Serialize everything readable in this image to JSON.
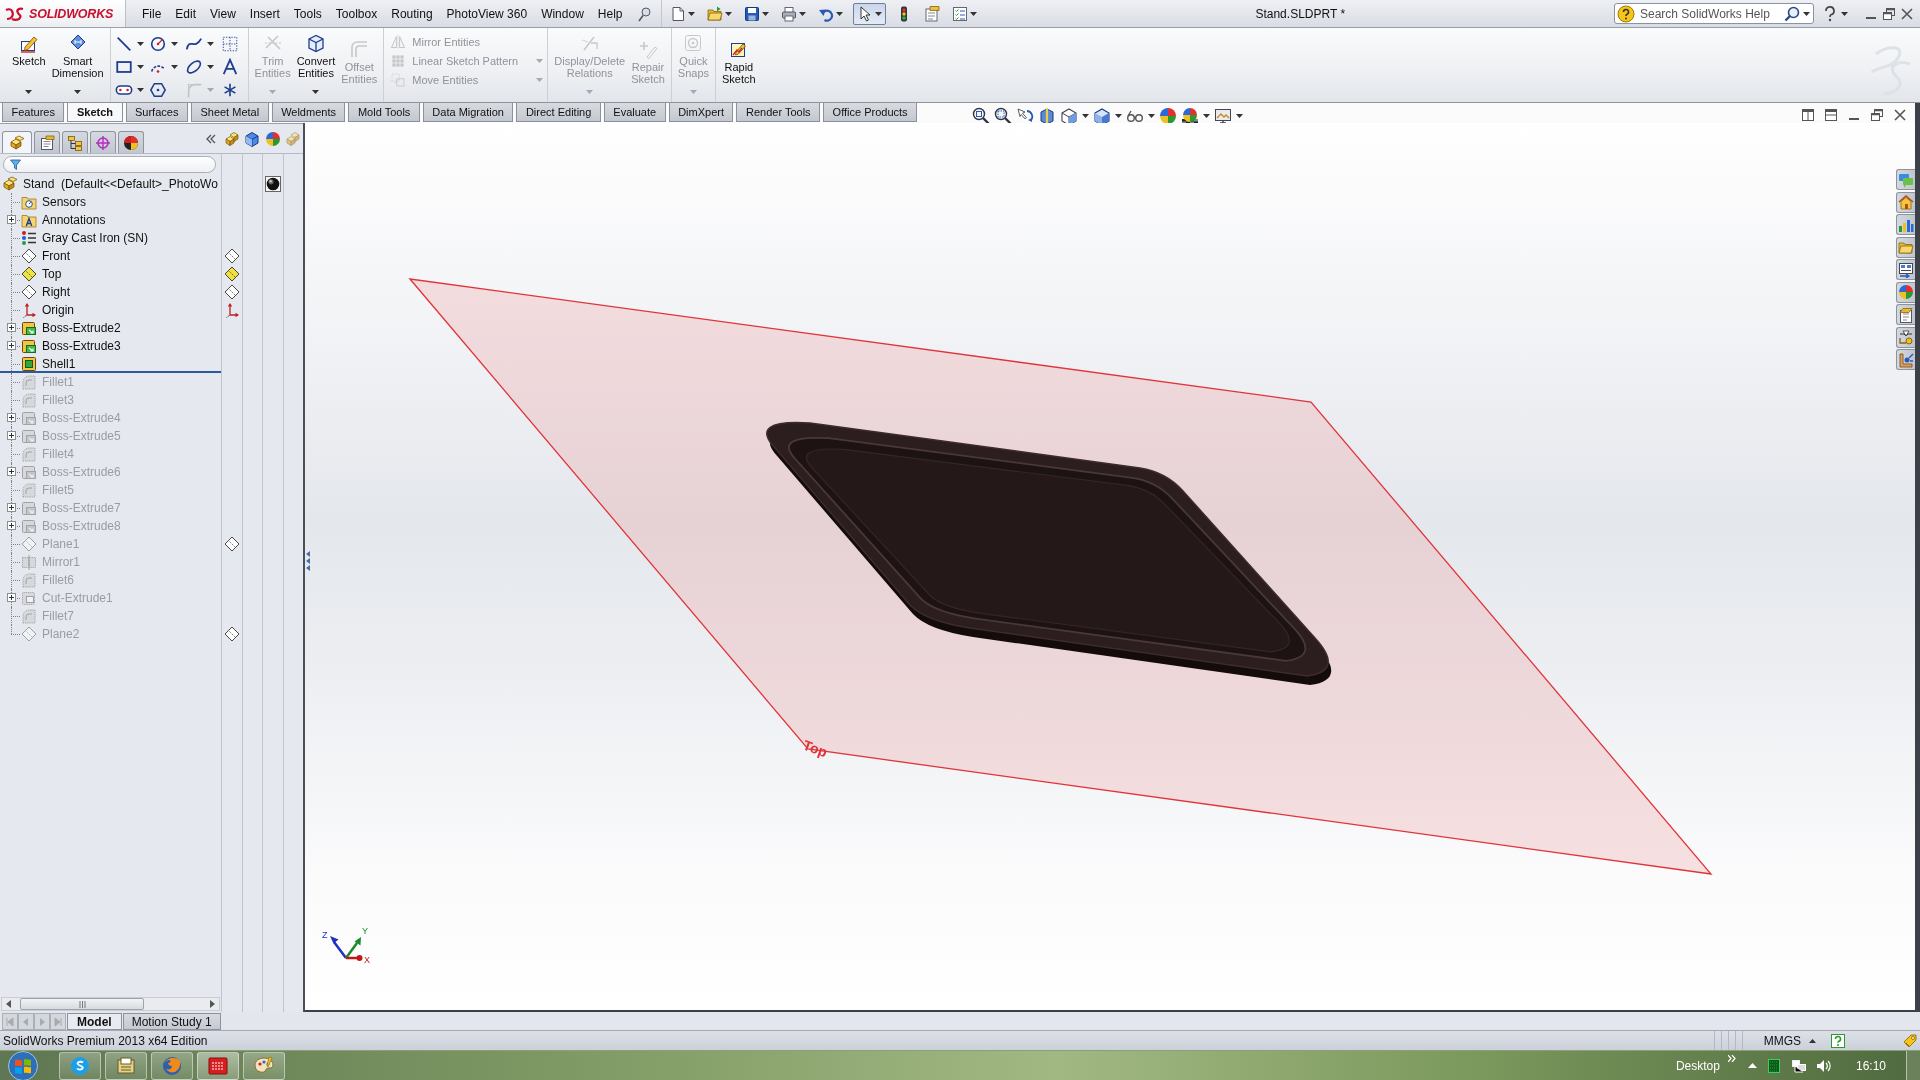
{
  "title_bar": {
    "logo": "SOLIDWORKS",
    "menu": [
      "File",
      "Edit",
      "View",
      "Insert",
      "Tools",
      "Toolbox",
      "Routing",
      "PhotoView 360",
      "Window",
      "Help"
    ],
    "quick_access": [
      {
        "kind": "new",
        "dropdown": true,
        "selected": false
      },
      {
        "kind": "open",
        "dropdown": true,
        "selected": false
      },
      {
        "kind": "save",
        "dropdown": true,
        "selected": false
      },
      {
        "kind": "print",
        "dropdown": true,
        "selected": false
      },
      {
        "kind": "undo",
        "dropdown": true,
        "selected": false
      },
      {
        "kind": "select",
        "dropdown": true,
        "selected": true
      },
      {
        "kind": "rebuild",
        "dropdown": false,
        "selected": false
      },
      {
        "kind": "file_properties",
        "dropdown": false,
        "selected": false
      },
      {
        "kind": "options",
        "dropdown": true,
        "selected": false
      }
    ],
    "document_title": "Stand.SLDPRT *",
    "search": {
      "placeholder": "Search SolidWorks Help"
    }
  },
  "command_manager": {
    "groups": [
      {
        "kind": "large",
        "items": [
          {
            "kind": "sketch",
            "label": "Sketch",
            "dropdown": true,
            "disabled": false
          },
          {
            "kind": "smart_dimension",
            "label": "Smart Dimension",
            "dropdown": true,
            "disabled": false
          }
        ]
      },
      {
        "kind": "grid",
        "items": [
          {
            "kind": "line",
            "dropdown": true,
            "disabled": false
          },
          {
            "kind": "circle",
            "dropdown": true,
            "disabled": false
          },
          {
            "kind": "spline",
            "dropdown": true,
            "disabled": false
          },
          {
            "kind": "grid",
            "dropdown": false,
            "disabled": false
          },
          {
            "kind": "rectangle",
            "dropdown": true,
            "disabled": false
          },
          {
            "kind": "arc",
            "dropdown": true,
            "disabled": false
          },
          {
            "kind": "ellipse",
            "dropdown": true,
            "disabled": false
          },
          {
            "kind": "text",
            "dropdown": false,
            "disabled": false
          },
          {
            "kind": "slot",
            "dropdown": true,
            "disabled": false
          },
          {
            "kind": "polygon",
            "dropdown": false,
            "disabled": false
          },
          {
            "kind": "fillet",
            "dropdown": true,
            "disabled": true
          },
          {
            "kind": "point",
            "dropdown": false,
            "disabled": false
          }
        ]
      },
      {
        "kind": "large",
        "items": [
          {
            "kind": "trim",
            "label": "Trim Entities",
            "dropdown": true,
            "disabled": true
          },
          {
            "kind": "convert",
            "label": "Convert Entities",
            "dropdown": true,
            "disabled": false
          },
          {
            "kind": "offset",
            "label": "Offset Entities",
            "dropdown": false,
            "disabled": true
          }
        ]
      },
      {
        "kind": "stack",
        "items": [
          {
            "kind": "mirror",
            "label": "Mirror Entities",
            "dropdown": false,
            "disabled": true
          },
          {
            "kind": "pattern",
            "label": "Linear Sketch Pattern",
            "dropdown": true,
            "disabled": true
          },
          {
            "kind": "move",
            "label": "Move Entities",
            "dropdown": true,
            "disabled": true
          }
        ]
      },
      {
        "kind": "large",
        "items": [
          {
            "kind": "relations",
            "label": "Display/Delete Relations",
            "dropdown": true,
            "disabled": true
          },
          {
            "kind": "repair",
            "label": "Repair Sketch",
            "dropdown": false,
            "disabled": true
          }
        ]
      },
      {
        "kind": "large",
        "items": [
          {
            "kind": "quick_snaps",
            "label": "Quick Snaps",
            "dropdown": true,
            "disabled": true
          }
        ]
      },
      {
        "kind": "large",
        "items": [
          {
            "kind": "rapid_sketch",
            "label": "Rapid Sketch",
            "dropdown": false,
            "disabled": false
          }
        ]
      }
    ]
  },
  "command_tabs": [
    {
      "label": "Features",
      "selected": false
    },
    {
      "label": "Sketch",
      "selected": true
    },
    {
      "label": "Surfaces",
      "selected": false
    },
    {
      "label": "Sheet Metal",
      "selected": false
    },
    {
      "label": "Weldments",
      "selected": false
    },
    {
      "label": "Mold Tools",
      "selected": false
    },
    {
      "label": "Data Migration",
      "selected": false
    },
    {
      "label": "Direct Editing",
      "selected": false
    },
    {
      "label": "Evaluate",
      "selected": false
    },
    {
      "label": "DimXpert",
      "selected": false
    },
    {
      "label": "Render Tools",
      "selected": false
    },
    {
      "label": "Office Products",
      "selected": false
    }
  ],
  "panel_tabs": [
    {
      "kind": "feature_manager",
      "selected": true
    },
    {
      "kind": "property_manager",
      "selected": false
    },
    {
      "kind": "configuration_manager",
      "selected": false
    },
    {
      "kind": "dimxpert_manager",
      "selected": false
    },
    {
      "kind": "display_manager",
      "selected": false
    }
  ],
  "feature_tree": {
    "label": "Stand  (Default<<Default>_PhotoWo",
    "kind": "part",
    "children": [
      {
        "label": "Sensors",
        "kind": "sensors",
        "rolled_back": false,
        "collapsed": false
      },
      {
        "label": "Annotations",
        "kind": "annotations",
        "rolled_back": false,
        "collapsed": true
      },
      {
        "label": "Gray Cast Iron (SN)",
        "kind": "material",
        "rolled_back": false,
        "collapsed": false
      },
      {
        "label": "Front",
        "kind": "plane",
        "rolled_back": false,
        "collapsed": false,
        "visible": false
      },
      {
        "label": "Top",
        "kind": "plane",
        "rolled_back": false,
        "collapsed": false,
        "visible": true
      },
      {
        "label": "Right",
        "kind": "plane",
        "rolled_back": false,
        "collapsed": false,
        "visible": false
      },
      {
        "label": "Origin",
        "kind": "origin",
        "rolled_back": false,
        "collapsed": false
      },
      {
        "label": "Boss-Extrude2",
        "kind": "extrude",
        "rolled_back": false,
        "collapsed": true
      },
      {
        "label": "Boss-Extrude3",
        "kind": "extrude",
        "rolled_back": false,
        "collapsed": true
      },
      {
        "label": "Shell1",
        "kind": "shell",
        "rolled_back": false,
        "collapsed": false
      },
      {
        "label": "Fillet1",
        "kind": "fillet",
        "rolled_back": true,
        "collapsed": false
      },
      {
        "label": "Fillet3",
        "kind": "fillet",
        "rolled_back": true,
        "collapsed": false
      },
      {
        "label": "Boss-Extrude4",
        "kind": "extrude",
        "rolled_back": true,
        "collapsed": true
      },
      {
        "label": "Boss-Extrude5",
        "kind": "extrude",
        "rolled_back": true,
        "collapsed": true
      },
      {
        "label": "Fillet4",
        "kind": "fillet",
        "rolled_back": true,
        "collapsed": false
      },
      {
        "label": "Boss-Extrude6",
        "kind": "extrude",
        "rolled_back": true,
        "collapsed": true
      },
      {
        "label": "Fillet5",
        "kind": "fillet",
        "rolled_back": true,
        "collapsed": false
      },
      {
        "label": "Boss-Extrude7",
        "kind": "extrude",
        "rolled_back": true,
        "collapsed": true
      },
      {
        "label": "Boss-Extrude8",
        "kind": "extrude",
        "rolled_back": true,
        "collapsed": true
      },
      {
        "label": "Plane1",
        "kind": "plane",
        "rolled_back": true,
        "collapsed": false,
        "visible": false
      },
      {
        "label": "Mirror1",
        "kind": "mirror",
        "rolled_back": true,
        "collapsed": false
      },
      {
        "label": "Fillet6",
        "kind": "fillet",
        "rolled_back": true,
        "collapsed": false
      },
      {
        "label": "Cut-Extrude1",
        "kind": "cut",
        "rolled_back": true,
        "collapsed": true
      },
      {
        "label": "Fillet7",
        "kind": "fillet",
        "rolled_back": true,
        "collapsed": false
      },
      {
        "label": "Plane2",
        "kind": "plane",
        "rolled_back": true,
        "collapsed": false,
        "visible": false
      }
    ]
  },
  "graphics": {
    "plane_label": "Top",
    "triad_labels": [
      {
        "kind": "z",
        "label": "Z"
      },
      {
        "kind": "y",
        "label": "Y"
      },
      {
        "kind": "x",
        "label": "X"
      }
    ]
  },
  "bottom_tabs": [
    {
      "label": "Model",
      "selected": true
    },
    {
      "label": "Motion Study 1",
      "selected": false
    }
  ],
  "status_bar": {
    "text": "SolidWorks Premium 2013 x64 Edition",
    "units": "MMGS"
  },
  "taskbar": {
    "desktop_label": "Desktop",
    "clock": "16:10"
  }
}
